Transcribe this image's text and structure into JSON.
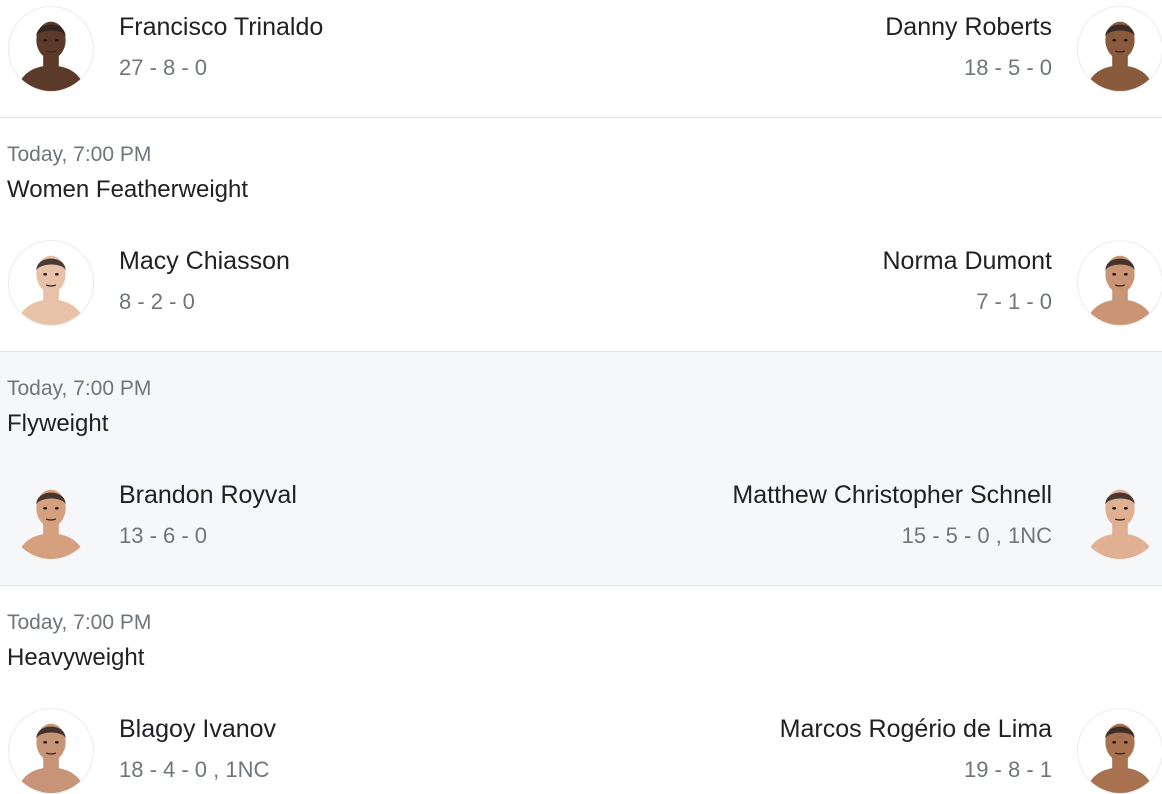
{
  "fights": [
    {
      "time": "",
      "weight_class": "",
      "left": {
        "name": "Francisco Trinaldo",
        "record": "27 - 8 - 0",
        "avatar_icon": "fighter-portrait-icon",
        "skin": "#5b3a29"
      },
      "right": {
        "name": "Danny Roberts",
        "record": "18 - 5 - 0",
        "avatar_icon": "fighter-portrait-icon",
        "skin": "#8a5a3c"
      }
    },
    {
      "time": "Today, 7:00 PM",
      "weight_class": "Women Featherweight",
      "left": {
        "name": "Macy Chiasson",
        "record": "8 - 2 - 0",
        "avatar_icon": "fighter-portrait-icon",
        "skin": "#e8c2a8"
      },
      "right": {
        "name": "Norma Dumont",
        "record": "7 - 1 - 0",
        "avatar_icon": "fighter-portrait-icon",
        "skin": "#c99575"
      }
    },
    {
      "time": "Today, 7:00 PM",
      "weight_class": "Flyweight",
      "left": {
        "name": "Brandon Royval",
        "record": "13 - 6 - 0",
        "avatar_icon": "fighter-portrait-icon",
        "skin": "#d4a07e"
      },
      "right": {
        "name": "Matthew Christopher Schnell",
        "record": "15 - 5 - 0 , 1NC",
        "avatar_icon": "fighter-portrait-icon",
        "skin": "#e0b092"
      }
    },
    {
      "time": "Today, 7:00 PM",
      "weight_class": "Heavyweight",
      "left": {
        "name": "Blagoy Ivanov",
        "record": "18 - 4 - 0 , 1NC",
        "avatar_icon": "fighter-portrait-icon",
        "skin": "#c79478"
      },
      "right": {
        "name": "Marcos Rogério de Lima",
        "record": "19 - 8 - 1",
        "avatar_icon": "fighter-portrait-icon",
        "skin": "#a8714f"
      }
    }
  ],
  "colors": {
    "highlight_row": "#f6f7f9",
    "divider": "#e3e3e3",
    "secondary_text": "#70757a",
    "primary_text": "#202124"
  }
}
